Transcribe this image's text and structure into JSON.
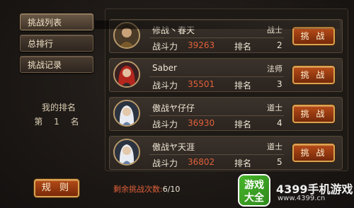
{
  "menu": {
    "items": [
      {
        "label": "挑战列表",
        "active": true
      },
      {
        "label": "总排行",
        "active": false
      },
      {
        "label": "挑战记录",
        "active": false
      }
    ]
  },
  "my_rank": {
    "title": "我的排名",
    "value": "第 1 名"
  },
  "rules_label": "规 则",
  "header": {
    "label": "战士"
  },
  "opponents": [
    {
      "name": "修战丶春天",
      "class": "战士",
      "power_label": "战斗力",
      "power": "39263",
      "rank_label": "排名",
      "rank": "2",
      "button": "挑 战"
    },
    {
      "name": "Saber",
      "class": "法师",
      "power_label": "战斗力",
      "power": "35501",
      "rank_label": "排名",
      "rank": "3",
      "button": "挑 战"
    },
    {
      "name": "傲战ヤ仔仔",
      "class": "道士",
      "power_label": "战斗力",
      "power": "36930",
      "rank_label": "排名",
      "rank": "4",
      "button": "挑 战"
    },
    {
      "name": "傲战ヤ天涯",
      "class": "道士",
      "power_label": "战斗力",
      "power": "36802",
      "rank_label": "排名",
      "rank": "5",
      "button": "挑 战"
    }
  ],
  "remaining": {
    "label": "剩余挑战次数:",
    "value": "6/10"
  },
  "watermark": {
    "badge_top": "游戏",
    "badge_bottom": "大全",
    "brand": "4399手机游戏",
    "url": "www.4399.cn"
  },
  "colors": {
    "accent": "#e0603a",
    "button": "#b64c18",
    "gold_border": "#d9a350"
  }
}
